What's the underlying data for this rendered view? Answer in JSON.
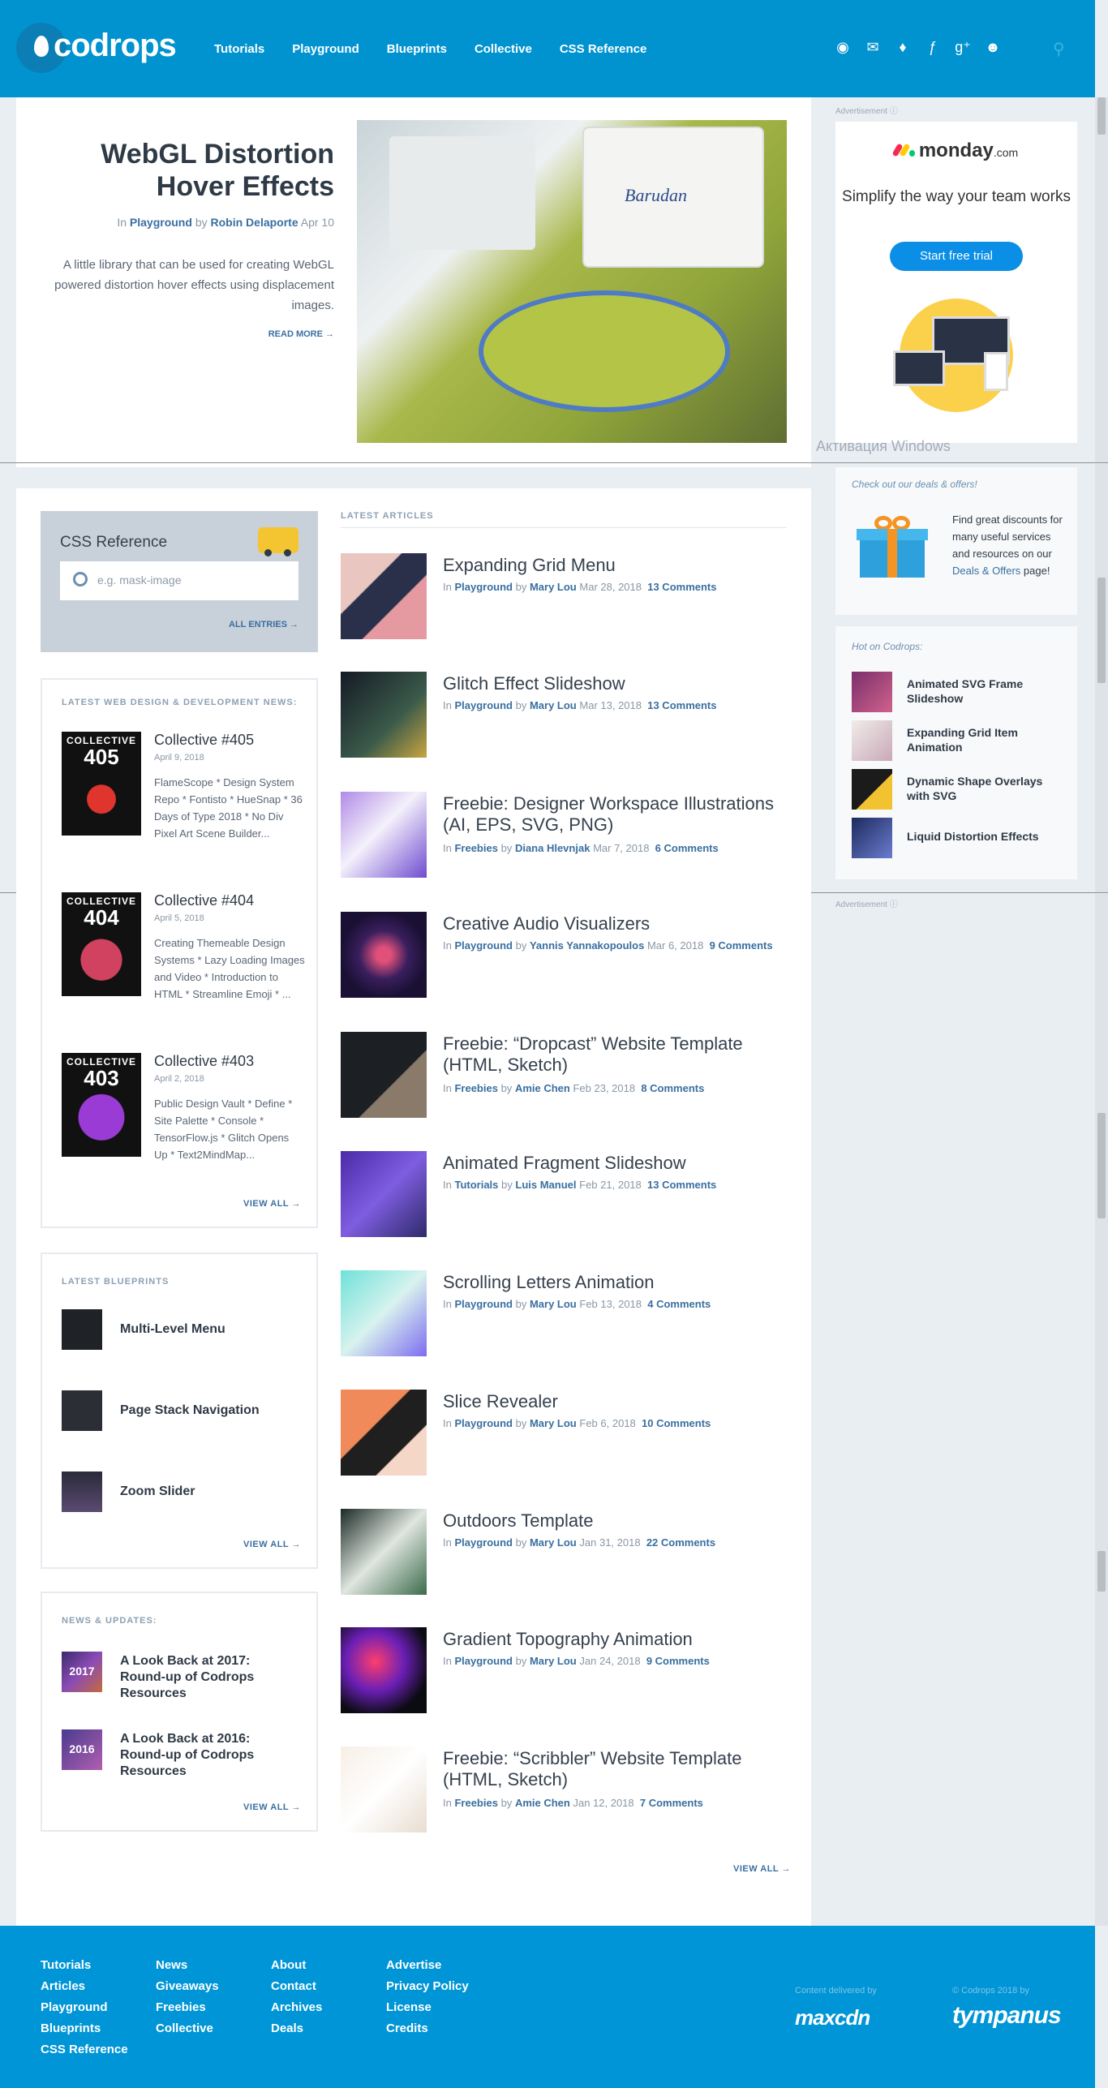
{
  "header": {
    "logo": "codrops",
    "nav": [
      "Tutorials",
      "Playground",
      "Blueprints",
      "Collective",
      "CSS Reference"
    ],
    "social_icons": [
      "rss-icon",
      "mail-icon",
      "twitter-icon",
      "facebook-icon",
      "google-plus-icon",
      "github-icon"
    ],
    "search_icon": "search-icon"
  },
  "featured": {
    "title_line1": "WebGL Distortion",
    "title_line2": "Hover Effects",
    "meta_in": "In",
    "category": "Playground",
    "meta_by": "by",
    "author": "Robin Delaporte",
    "date": "Apr 10",
    "description": "A little library that can be used for creating WebGL powered distortion hover effects using displacement images.",
    "read_more": "READ MORE →",
    "image_brand": "Barudan"
  },
  "ad": {
    "label": "Advertisement ⓘ",
    "brand": "monday",
    "brand_suffix": ".com",
    "headline": "Simplify the way your team works",
    "cta": "Start free trial"
  },
  "os_watermark": "Активация Windows",
  "deals": {
    "title": "Check out our deals & offers!",
    "text_before": "Find great discounts for many useful services and resources on our ",
    "link": "Deals & Offers",
    "text_after": " page!"
  },
  "hot": {
    "title": "Hot on Codrops:",
    "items": [
      "Animated SVG Frame Slideshow",
      "Expanding Grid Item Animation",
      "Dynamic Shape Overlays with SVG",
      "Liquid Distortion Effects"
    ]
  },
  "ad2_label": "Advertisement ⓘ",
  "css_reference": {
    "title": "CSS Reference",
    "placeholder": "e.g. mask-image",
    "all_entries": "ALL ENTRIES →"
  },
  "news": {
    "label": "LATEST WEB DESIGN & DEVELOPMENT NEWS:",
    "items": [
      {
        "badge": "COLLECTIVE",
        "num": "405",
        "title": "Collective #405",
        "date": "April 9, 2018",
        "desc": "FlameScope * Design System Repo * Fontisto * HueSnap * 36 Days of Type 2018 * No Div Pixel Art Scene Builder..."
      },
      {
        "badge": "COLLECTIVE",
        "num": "404",
        "title": "Collective #404",
        "date": "April 5, 2018",
        "desc": "Creating Themeable Design Systems * Lazy Loading Images and Video * Introduction to HTML * Streamline Emoji * ..."
      },
      {
        "badge": "COLLECTIVE",
        "num": "403",
        "title": "Collective #403",
        "date": "April 2, 2018",
        "desc": "Public Design Vault * Define * Site Palette * Console * TensorFlow.js * Glitch Opens Up * Text2MindMap..."
      }
    ],
    "view_all": "VIEW ALL →"
  },
  "blueprints": {
    "label": "LATEST BLUEPRINTS",
    "items": [
      "Multi-Level Menu",
      "Page Stack Navigation",
      "Zoom Slider"
    ],
    "view_all": "VIEW ALL →"
  },
  "updates": {
    "label": "NEWS & UPDATES:",
    "items": [
      {
        "year": "2017",
        "title": "A Look Back at 2017: Round-up of Codrops Resources"
      },
      {
        "year": "2016",
        "title": "A Look Back at 2016: Round-up of Codrops Resources"
      }
    ],
    "view_all": "VIEW ALL →"
  },
  "latest": {
    "label": "LATEST ARTICLES",
    "articles": [
      {
        "title": "Expanding Grid Menu",
        "category": "Playground",
        "author": "Mary Lou",
        "date": "Mar 28, 2018",
        "comments": "13 Comments"
      },
      {
        "title": "Glitch Effect Slideshow",
        "category": "Playground",
        "author": "Mary Lou",
        "date": "Mar 13, 2018",
        "comments": "13 Comments"
      },
      {
        "title": "Freebie: Designer Workspace Illustrations (AI, EPS, SVG, PNG)",
        "category": "Freebies",
        "author": "Diana Hlevnjak",
        "date": "Mar 7, 2018",
        "comments": "6 Comments"
      },
      {
        "title": "Creative Audio Visualizers",
        "category": "Playground",
        "author": "Yannis Yannakopoulos",
        "date": "Mar 6, 2018",
        "comments": "9 Comments"
      },
      {
        "title": "Freebie: “Dropcast” Website Template (HTML, Sketch)",
        "category": "Freebies",
        "author": "Amie Chen",
        "date": "Feb 23, 2018",
        "comments": "8 Comments"
      },
      {
        "title": "Animated Fragment Slideshow",
        "category": "Tutorials",
        "author": "Luis Manuel",
        "date": "Feb 21, 2018",
        "comments": "13 Comments"
      },
      {
        "title": "Scrolling Letters Animation",
        "category": "Playground",
        "author": "Mary Lou",
        "date": "Feb 13, 2018",
        "comments": "4 Comments"
      },
      {
        "title": "Slice Revealer",
        "category": "Playground",
        "author": "Mary Lou",
        "date": "Feb 6, 2018",
        "comments": "10 Comments"
      },
      {
        "title": "Outdoors Template",
        "category": "Playground",
        "author": "Mary Lou",
        "date": "Jan 31, 2018",
        "comments": "22 Comments"
      },
      {
        "title": "Gradient Topography Animation",
        "category": "Playground",
        "author": "Mary Lou",
        "date": "Jan 24, 2018",
        "comments": "9 Comments"
      },
      {
        "title": "Freebie: “Scribbler” Website Template (HTML, Sketch)",
        "category": "Freebies",
        "author": "Amie Chen",
        "date": "Jan 12, 2018",
        "comments": "7 Comments"
      }
    ],
    "meta_in": "In",
    "meta_by": "by",
    "view_all": "VIEW ALL →"
  },
  "footer": {
    "col1": [
      "Tutorials",
      "Articles",
      "Playground",
      "Blueprints",
      "CSS Reference"
    ],
    "col2": [
      "News",
      "Giveaways",
      "Freebies",
      "Collective"
    ],
    "col3": [
      "About",
      "Contact",
      "Archives",
      "Deals"
    ],
    "col4": [
      "Advertise",
      "Privacy Policy",
      "License",
      "Credits"
    ],
    "delivered_by": "Content delivered by",
    "cdn": "maxcdn",
    "copyright": "© Codrops 2018 by",
    "owner": "tympanus"
  }
}
